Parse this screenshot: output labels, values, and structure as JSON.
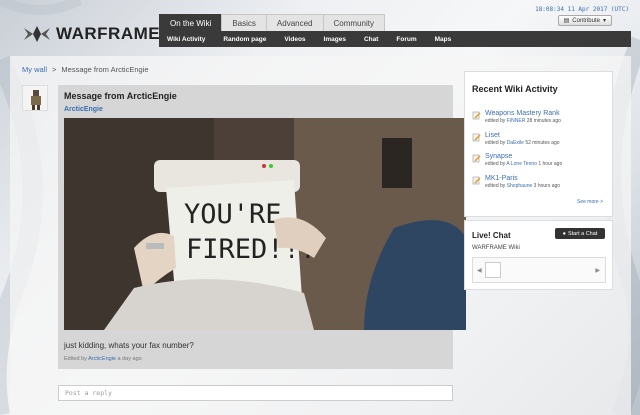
{
  "header": {
    "logo_text": "WARFRAME",
    "timestamp": "18:08:34 11 Apr 2017 (UTC)",
    "contribute_label": "Contribute",
    "tabs": [
      {
        "label": "On the Wiki",
        "active": true
      },
      {
        "label": "Basics",
        "active": false
      },
      {
        "label": "Advanced",
        "active": false
      },
      {
        "label": "Community",
        "active": false
      }
    ],
    "subnav": [
      "Wiki Activity",
      "Random page",
      "Videos",
      "Images",
      "Chat",
      "Forum",
      "Maps"
    ]
  },
  "breadcrumb": {
    "wall_link": "My wall",
    "separator": ">",
    "current": "Message from ArcticEngie"
  },
  "post": {
    "title": "Message from ArcticEngie",
    "author": "ArcticEngie",
    "image_sign_line1": "YOU'RE",
    "image_sign_line2": "FIRED!!!",
    "text": "just kidding, whats your fax number?",
    "meta_prefix": "Edited by",
    "meta_author": "ArcticEngie",
    "meta_time": "a day ago"
  },
  "reply": {
    "placeholder": "Post a reply"
  },
  "rail": {
    "title": "Recent Wiki Activity",
    "items": [
      {
        "title": "Weapons Mastery Rank",
        "prefix": "edited by",
        "user": "FINNER",
        "time": "28 minutes ago"
      },
      {
        "title": "Liset",
        "prefix": "edited by",
        "user": "DaExile",
        "time": "52 minutes ago"
      },
      {
        "title": "Synapse",
        "prefix": "edited by",
        "user": "A Lone Tenno",
        "time": "1 hour ago"
      },
      {
        "title": "MK1-Paris",
        "prefix": "edited by",
        "user": "Shophaune",
        "time": "3 hours ago"
      }
    ],
    "see_more": "See more >"
  },
  "chat": {
    "title": "Live! Chat",
    "subtitle": "WARFRAME Wiki",
    "button_label": "Start a Chat"
  },
  "colors": {
    "link": "#3a6fb0",
    "nav_dark": "#3a3a3a"
  }
}
